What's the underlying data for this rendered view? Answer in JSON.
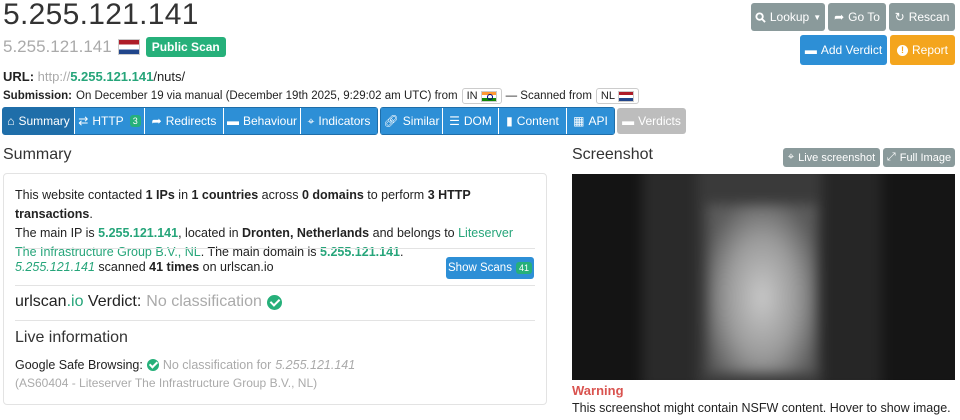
{
  "header": {
    "title": "5.255.121.141",
    "subtitle": "5.255.121.141",
    "subtitle_flag": "NL",
    "public_scan_badge": "Public Scan"
  },
  "url": {
    "label": "URL:",
    "protocol": "http://",
    "host": "5.255.121.141",
    "path": "/nuts/"
  },
  "submission": {
    "label": "Submission:",
    "text": "On December 19 via manual (December 19th 2025, 9:29:02 am UTC) from",
    "from_country": "IN",
    "scanned_from_label": "— Scanned from",
    "scanned_from_country": "NL"
  },
  "actions": {
    "lookup": "Lookup",
    "goto": "Go To",
    "rescan": "Rescan",
    "add_verdict": "Add Verdict",
    "report": "Report"
  },
  "tabs": [
    {
      "label": "Summary",
      "icon": "home-icon"
    },
    {
      "label": "HTTP",
      "icon": "exchange-icon",
      "count": "3"
    },
    {
      "label": "Redirects",
      "icon": "share-icon"
    },
    {
      "label": "Behaviour",
      "icon": "comment-icon"
    },
    {
      "label": "Indicators",
      "icon": "crosshairs-icon"
    },
    {
      "label": "Similar",
      "icon": "link-icon"
    },
    {
      "label": "DOM",
      "icon": "list-icon"
    },
    {
      "label": "Content",
      "icon": "file-icon"
    },
    {
      "label": "API",
      "icon": "qrcode-icon"
    },
    {
      "label": "Verdicts",
      "icon": "comment-icon"
    }
  ],
  "summary": {
    "heading": "Summary",
    "p1": "This website contacted ",
    "ips": "1 IPs",
    "p2": " in ",
    "countries": "1 countries",
    "p3": " across ",
    "domains": "0 domains",
    "p4": " to perform ",
    "transactions": "3 HTTP transactions",
    "p5": ".",
    "p6": "The main IP is ",
    "main_ip": "5.255.121.141",
    "p7": ", located in ",
    "location": "Dronten, Netherlands",
    "p8": " and belongs to ",
    "asn_owner": "Liteserver The Infrastructure Group B.V., NL",
    "p9": ". The main domain is ",
    "main_domain": "5.255.121.141",
    "p10": ".",
    "scanned_ip": "5.255.121.141",
    "scanned_mid": " scanned ",
    "scanned_times": "41 times",
    "scanned_on": " on urlscan.io",
    "show_scans": "Show Scans",
    "show_scans_count": "41",
    "verdict_prefix_a": "urlscan",
    "verdict_prefix_b": ".io",
    "verdict_label": " Verdict:",
    "verdict_value": "No classification",
    "live_heading": "Live information",
    "gsb_label": "Google Safe Browsing:",
    "gsb_value": "No classification for",
    "gsb_ip": "5.255.121.141",
    "asn_line": "(AS60404 - Liteserver The Infrastructure Group B.V., NL)"
  },
  "screenshot": {
    "heading": "Screenshot",
    "live_button": "Live screenshot",
    "full_button": "Full Image",
    "warning_title": "Warning",
    "warning_text": "This screenshot might contain NSFW content. Hover to show image."
  },
  "colors": {
    "accent_green": "#26b07a",
    "button_blue": "#2d8fd6",
    "button_grey": "#8a9a9b",
    "button_orange": "#f4a51d",
    "warning_red": "#d9534f"
  }
}
